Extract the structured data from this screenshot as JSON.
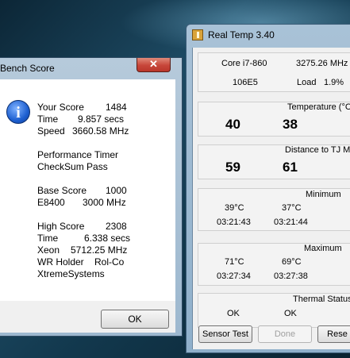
{
  "realtemp": {
    "title": "Real Temp 3.40",
    "cpu_model": "Core i7-860",
    "cpu_freq": "3275.26 MHz",
    "cpuid": "106E5",
    "load_label": "Load",
    "load_value": "1.9%",
    "temperature_label": "Temperature (°C)",
    "temp_core0": "40",
    "temp_core1": "38",
    "distance_label": "Distance to TJ Max",
    "dist_core0": "59",
    "dist_core1": "61",
    "minimum_label": "Minimum",
    "min_temp0": "39°C",
    "min_temp1": "37°C",
    "min_time0": "03:21:43",
    "min_time1": "03:21:44",
    "maximum_label": "Maximum",
    "max_temp0": "71°C",
    "max_temp1": "69°C",
    "max_time0": "03:27:34",
    "max_time1": "03:27:38",
    "thermal_status_label": "Thermal Status",
    "status0": "OK",
    "status1": "OK",
    "buttons": {
      "sensor_test": "Sensor Test",
      "done": "Done",
      "reset": "Rese"
    }
  },
  "bench": {
    "title": "Bench Score",
    "close_glyph": "✕",
    "your_score_label": "Your Score",
    "your_score_value": "1484",
    "time_label": "Time",
    "time_value": "9.857 secs",
    "speed_label": "Speed",
    "speed_value": "3660.58 MHz",
    "perf_timer": "Performance Timer",
    "checksum": "CheckSum Pass",
    "base_score_label": "Base Score",
    "base_score_value": "1000",
    "base_cpu": "E8400",
    "base_freq": "3000 MHz",
    "high_score_label": "High Score",
    "high_score_value": "2308",
    "high_time_label": "Time",
    "high_time_value": "6.338 secs",
    "high_cpu": "Xeon",
    "high_freq": "5712.25 MHz",
    "wr_label": "WR Holder",
    "wr_name": "Rol-Co",
    "site": "XtremeSystems",
    "ok_label": "OK"
  },
  "colors": {
    "close_button": "#c7463a",
    "info_icon": "#1d5fd0",
    "window_frame": "#9db8cf"
  }
}
